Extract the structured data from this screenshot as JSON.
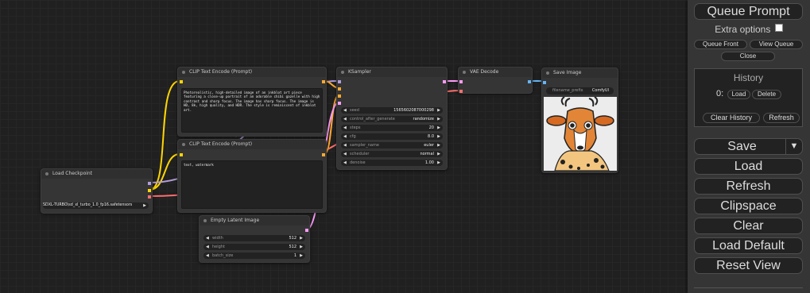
{
  "nodes": {
    "clip_text_pos": {
      "title": "CLIP Text Encode (Prompt)",
      "text": "Photorealistic, high-detailed image of an inkblot art piece featuring a close-up portrait of an adorable chibi gazelle with high contrast and sharp focus. The image has sharp focus. The image is HD, 8k, high quality, and HDR. The style is reminiscent of inkblot art."
    },
    "clip_text_neg": {
      "title": "CLIP Text Encode (Prompt)",
      "text": "text, watermark"
    },
    "ksampler": {
      "title": "KSampler",
      "widgets": [
        {
          "label": "seed",
          "value": "1565602087000298"
        },
        {
          "label": "control_after_generate",
          "value": "randomize"
        },
        {
          "label": "steps",
          "value": "20"
        },
        {
          "label": "cfg",
          "value": "8.0"
        },
        {
          "label": "sampler_name",
          "value": "euler"
        },
        {
          "label": "scheduler",
          "value": "normal"
        },
        {
          "label": "denoise",
          "value": "1.00"
        }
      ]
    },
    "vae_decode": {
      "title": "VAE Decode"
    },
    "save_image": {
      "title": "Save Image",
      "prefix_label": "filename_prefix",
      "prefix_value": "ComfyUI"
    },
    "load_checkpoint": {
      "title": "Load Checkpoint",
      "ckpt_name": "SDXL-TURBO\\sd_xl_turbo_1.0_fp16.safetensors"
    },
    "empty_latent": {
      "title": "Empty Latent Image",
      "widgets": [
        {
          "label": "width",
          "value": "512"
        },
        {
          "label": "height",
          "value": "512"
        },
        {
          "label": "batch_size",
          "value": "1"
        }
      ]
    }
  },
  "menu": {
    "queue_prompt": "Queue Prompt",
    "extra_options": "Extra options",
    "queue_front": "Queue Front",
    "view_queue": "View Queue",
    "close": "Close",
    "history_title": "History",
    "history_item_index": "0:",
    "history_load": "Load",
    "history_delete": "Delete",
    "clear_history": "Clear History",
    "refresh_small": "Refresh",
    "save": "Save",
    "save_dropdown": "▼",
    "load": "Load",
    "refresh": "Refresh",
    "clipspace": "Clipspace",
    "clear": "Clear",
    "load_default": "Load Default",
    "reset_view": "Reset View"
  },
  "colors": {
    "clip": "#ffd500",
    "model": "#b39ddb",
    "vae": "#ff6e6e",
    "conditioning": "#ffa931",
    "latent": "#ff9cf9",
    "image": "#64b5f6"
  }
}
